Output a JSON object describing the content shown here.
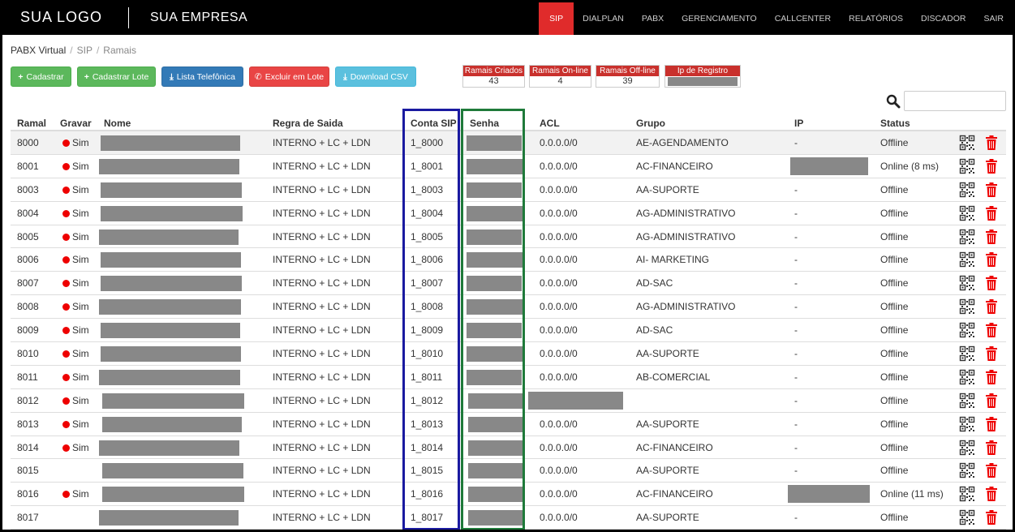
{
  "header": {
    "logo": "SUA LOGO",
    "company": "SUA EMPRESA",
    "nav": [
      {
        "label": "SIP",
        "active": true
      },
      {
        "label": "DIALPLAN",
        "active": false
      },
      {
        "label": "PABX",
        "active": false
      },
      {
        "label": "GERENCIAMENTO",
        "active": false
      },
      {
        "label": "CALLCENTER",
        "active": false
      },
      {
        "label": "RELATÓRIOS",
        "active": false
      },
      {
        "label": "DISCADOR",
        "active": false
      },
      {
        "label": "SAIR",
        "active": false
      }
    ]
  },
  "breadcrumb": [
    "PABX Virtual",
    "SIP",
    "Ramais"
  ],
  "actions": [
    {
      "label": "Cadastrar",
      "icon": "+",
      "color": "green"
    },
    {
      "label": "Cadastrar Lote",
      "icon": "+",
      "color": "green"
    },
    {
      "label": "Lista Telefônica",
      "icon": "⤓",
      "color": "blue"
    },
    {
      "label": "Excluir em Lote",
      "icon": "✆",
      "color": "red"
    },
    {
      "label": "Download CSV",
      "icon": "⤓",
      "color": "cyan"
    }
  ],
  "stats": [
    {
      "label": "Ramais Criados",
      "value": "43"
    },
    {
      "label": "Ramais On-line",
      "value": "4"
    },
    {
      "label": "Ramais Off-line",
      "value": "39"
    },
    {
      "label": "Ip de Registro",
      "value": ""
    }
  ],
  "search": {
    "placeholder": ""
  },
  "table": {
    "columns": [
      "Ramal",
      "Gravar",
      "Nome",
      "Regra de Saida",
      "Conta SIP",
      "Senha",
      "ACL",
      "Grupo",
      "IP",
      "Status"
    ],
    "rows": [
      {
        "ramal": "8000",
        "gravar": "Sim",
        "regra": "INTERNO + LC + LDN",
        "conta": "1_8000",
        "acl": "0.0.0.0/0",
        "grupo": "AE-AGENDAMENTO",
        "ip": "-",
        "status": "Offline"
      },
      {
        "ramal": "8001",
        "gravar": "Sim",
        "regra": "INTERNO + LC + LDN",
        "conta": "1_8001",
        "acl": "0.0.0.0/0",
        "grupo": "AC-FINANCEIRO",
        "ip": "",
        "status": "Online (8 ms)"
      },
      {
        "ramal": "8003",
        "gravar": "Sim",
        "regra": "INTERNO + LC + LDN",
        "conta": "1_8003",
        "acl": "0.0.0.0/0",
        "grupo": "AA-SUPORTE",
        "ip": "-",
        "status": "Offline"
      },
      {
        "ramal": "8004",
        "gravar": "Sim",
        "regra": "INTERNO + LC + LDN",
        "conta": "1_8004",
        "acl": "0.0.0.0/0",
        "grupo": "AG-ADMINISTRATIVO",
        "ip": "-",
        "status": "Offline"
      },
      {
        "ramal": "8005",
        "gravar": "Sim",
        "regra": "INTERNO + LC + LDN",
        "conta": "1_8005",
        "acl": "0.0.0.0/0",
        "grupo": "AG-ADMINISTRATIVO",
        "ip": "-",
        "status": "Offline"
      },
      {
        "ramal": "8006",
        "gravar": "Sim",
        "regra": "INTERNO + LC + LDN",
        "conta": "1_8006",
        "acl": "0.0.0.0/0",
        "grupo": "AI- MARKETING",
        "ip": "-",
        "status": "Offline"
      },
      {
        "ramal": "8007",
        "gravar": "Sim",
        "regra": "INTERNO + LC + LDN",
        "conta": "1_8007",
        "acl": "0.0.0.0/0",
        "grupo": "AD-SAC",
        "ip": "-",
        "status": "Offline"
      },
      {
        "ramal": "8008",
        "gravar": "Sim",
        "regra": "INTERNO + LC + LDN",
        "conta": "1_8008",
        "acl": "0.0.0.0/0",
        "grupo": "AG-ADMINISTRATIVO",
        "ip": "-",
        "status": "Offline"
      },
      {
        "ramal": "8009",
        "gravar": "Sim",
        "regra": "INTERNO + LC + LDN",
        "conta": "1_8009",
        "acl": "0.0.0.0/0",
        "grupo": "AD-SAC",
        "ip": "-",
        "status": "Offline"
      },
      {
        "ramal": "8010",
        "gravar": "Sim",
        "regra": "INTERNO + LC + LDN",
        "conta": "1_8010",
        "acl": "0.0.0.0/0",
        "grupo": "AA-SUPORTE",
        "ip": "-",
        "status": "Offline"
      },
      {
        "ramal": "8011",
        "gravar": "Sim",
        "regra": "INTERNO + LC + LDN",
        "conta": "1_8011",
        "acl": "0.0.0.0/0",
        "grupo": "AB-COMERCIAL",
        "ip": "-",
        "status": "Offline"
      },
      {
        "ramal": "8012",
        "gravar": "Sim",
        "regra": "INTERNO + LC + LDN",
        "conta": "1_8012",
        "acl": "",
        "grupo": "",
        "ip": "-",
        "status": "Offline"
      },
      {
        "ramal": "8013",
        "gravar": "Sim",
        "regra": "INTERNO + LC + LDN",
        "conta": "1_8013",
        "acl": "0.0.0.0/0",
        "grupo": "AA-SUPORTE",
        "ip": "-",
        "status": "Offline"
      },
      {
        "ramal": "8014",
        "gravar": "Sim",
        "regra": "INTERNO + LC + LDN",
        "conta": "1_8014",
        "acl": "0.0.0.0/0",
        "grupo": "AC-FINANCEIRO",
        "ip": "-",
        "status": "Offline"
      },
      {
        "ramal": "8015",
        "gravar": "",
        "regra": "INTERNO + LC + LDN",
        "conta": "1_8015",
        "acl": "0.0.0.0/0",
        "grupo": "AA-SUPORTE",
        "ip": "-",
        "status": "Offline"
      },
      {
        "ramal": "8016",
        "gravar": "Sim",
        "regra": "INTERNO + LC + LDN",
        "conta": "1_8016",
        "acl": "0.0.0.0/0",
        "grupo": "AC-FINANCEIRO",
        "ip": "",
        "status": "Online (11 ms)"
      },
      {
        "ramal": "8017",
        "gravar": "",
        "regra": "INTERNO + LC + LDN",
        "conta": "1_8017",
        "acl": "0.0.0.0/0",
        "grupo": "AA-SUPORTE",
        "ip": "-",
        "status": "Offline"
      }
    ]
  },
  "colors": {
    "accent": "#e02b2b",
    "conta_box": "#1a1aa0",
    "senha_box": "#1f7a3a",
    "redacted": "#888888"
  },
  "icons": {
    "search": "search-icon",
    "qr": "qr-code-icon",
    "delete": "trash-icon"
  }
}
